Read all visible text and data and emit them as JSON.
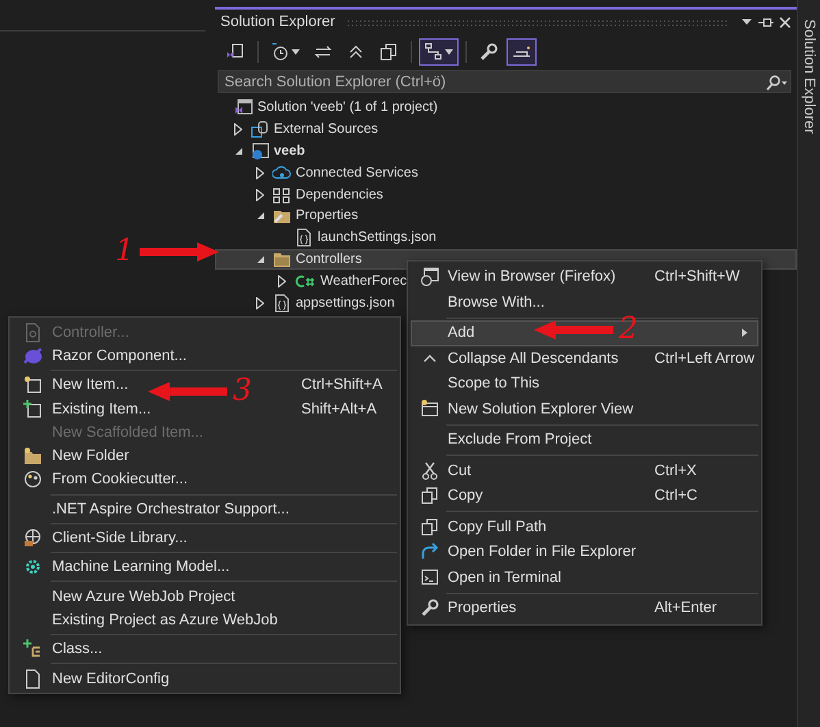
{
  "panel": {
    "title": "Solution Explorer",
    "search": {
      "placeholder": "Search Solution Explorer (Ctrl+ö)"
    },
    "toolbar": [
      {
        "on": false,
        "dropdown": false
      },
      {
        "on": false,
        "dropdown": true
      },
      {
        "on": false,
        "dropdown": false
      },
      {
        "on": false,
        "dropdown": false
      },
      {
        "on": false,
        "dropdown": false
      },
      {
        "on": true,
        "dropdown": true
      },
      {
        "on": false,
        "dropdown": false
      },
      {
        "on": true,
        "dropdown": false
      }
    ],
    "tree": [
      {
        "label": "Solution 'veeb' (1 of 1 project)",
        "kind": "solution",
        "selected": false,
        "children": [
          {
            "label": "External Sources",
            "kind": "external",
            "selected": false,
            "expanded": false
          },
          {
            "label": "veeb",
            "kind": "project",
            "bold": true,
            "selected": false,
            "expanded": true,
            "children": [
              {
                "label": "Connected Services",
                "kind": "services",
                "selected": false,
                "expanded": false
              },
              {
                "label": "Dependencies",
                "kind": "dependencies",
                "selected": false,
                "expanded": false
              },
              {
                "label": "Properties",
                "kind": "properties",
                "selected": false,
                "expanded": true,
                "children": [
                  {
                    "label": "launchSettings.json",
                    "kind": "json",
                    "selected": false
                  }
                ]
              },
              {
                "label": "Controllers",
                "kind": "folder",
                "selected": true,
                "expanded": true,
                "children": [
                  {
                    "label": "WeatherForec",
                    "kind": "csharp",
                    "selected": false,
                    "expanded": false
                  }
                ]
              },
              {
                "label": "appsettings.json",
                "kind": "json",
                "selected": false,
                "expanded": false
              }
            ]
          }
        ]
      }
    ]
  },
  "side_tab": {
    "label": "Solution Explorer"
  },
  "context_menu": {
    "items": [
      {
        "kind": "item",
        "label": "View in Browser (Firefox)",
        "shortcut": "Ctrl+Shift+W",
        "disabled": false,
        "selected": false
      },
      {
        "kind": "item",
        "label": "Browse With...",
        "disabled": false,
        "selected": false
      },
      {
        "kind": "separator"
      },
      {
        "kind": "item",
        "label": "Add",
        "disabled": false,
        "selected": true,
        "submenu": true
      },
      {
        "kind": "item",
        "label": "Collapse All Descendants",
        "shortcut": "Ctrl+Left Arrow",
        "disabled": false,
        "selected": false
      },
      {
        "kind": "item",
        "label": "Scope to This",
        "disabled": false,
        "selected": false
      },
      {
        "kind": "item",
        "label": "New Solution Explorer View",
        "disabled": false,
        "selected": false
      },
      {
        "kind": "separator"
      },
      {
        "kind": "item",
        "label": "Exclude From Project",
        "disabled": false,
        "selected": false
      },
      {
        "kind": "separator"
      },
      {
        "kind": "item",
        "label": "Cut",
        "shortcut": "Ctrl+X",
        "disabled": false,
        "selected": false
      },
      {
        "kind": "item",
        "label": "Copy",
        "shortcut": "Ctrl+C",
        "disabled": false,
        "selected": false
      },
      {
        "kind": "separator"
      },
      {
        "kind": "item",
        "label": "Copy Full Path",
        "disabled": false,
        "selected": false
      },
      {
        "kind": "item",
        "label": "Open Folder in File Explorer",
        "disabled": false,
        "selected": false
      },
      {
        "kind": "item",
        "label": "Open in Terminal",
        "disabled": false,
        "selected": false
      },
      {
        "kind": "separator"
      },
      {
        "kind": "item",
        "label": "Properties",
        "shortcut": "Alt+Enter",
        "disabled": false,
        "selected": false
      }
    ]
  },
  "add_submenu": {
    "items": [
      {
        "kind": "item",
        "label": "Controller...",
        "disabled": true
      },
      {
        "kind": "item",
        "label": "Razor Component...",
        "disabled": false
      },
      {
        "kind": "separator"
      },
      {
        "kind": "item",
        "label": "New Item...",
        "shortcut": "Ctrl+Shift+A",
        "disabled": false
      },
      {
        "kind": "item",
        "label": "Existing Item...",
        "shortcut": "Shift+Alt+A",
        "disabled": false
      },
      {
        "kind": "item",
        "label": "New Scaffolded Item...",
        "disabled": true
      },
      {
        "kind": "item",
        "label": "New Folder",
        "disabled": false
      },
      {
        "kind": "item",
        "label": "From Cookiecutter...",
        "disabled": false
      },
      {
        "kind": "separator"
      },
      {
        "kind": "item",
        "label": ".NET Aspire Orchestrator Support...",
        "disabled": false
      },
      {
        "kind": "separator"
      },
      {
        "kind": "item",
        "label": "Client-Side Library...",
        "disabled": false
      },
      {
        "kind": "separator"
      },
      {
        "kind": "item",
        "label": "Machine Learning Model...",
        "disabled": false
      },
      {
        "kind": "separator"
      },
      {
        "kind": "item",
        "label": "New Azure WebJob Project",
        "disabled": false
      },
      {
        "kind": "item",
        "label": "Existing Project as Azure WebJob",
        "disabled": false
      },
      {
        "kind": "separator"
      },
      {
        "kind": "item",
        "label": "Class...",
        "disabled": false
      },
      {
        "kind": "separator"
      },
      {
        "kind": "item",
        "label": "New EditorConfig",
        "disabled": false
      }
    ]
  },
  "annotations": [
    {
      "label": "1"
    },
    {
      "label": "2"
    },
    {
      "label": "3"
    }
  ]
}
